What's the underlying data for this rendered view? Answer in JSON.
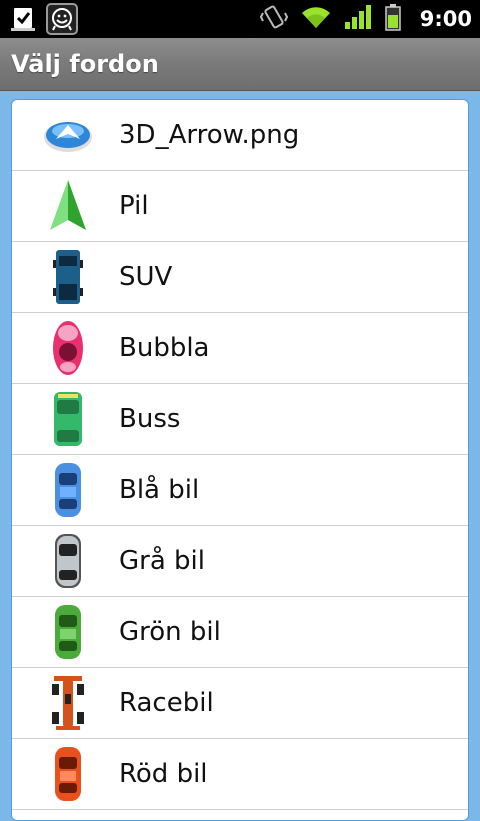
{
  "status": {
    "time": "9:00"
  },
  "header": {
    "title": "Välj fordon"
  },
  "vehicles": [
    {
      "label": "3D_Arrow.png",
      "icon": "3d-arrow-icon"
    },
    {
      "label": "Pil",
      "icon": "green-arrow-icon"
    },
    {
      "label": "SUV",
      "icon": "suv-icon"
    },
    {
      "label": "Bubbla",
      "icon": "bubble-car-icon"
    },
    {
      "label": "Buss",
      "icon": "bus-icon"
    },
    {
      "label": "Blå bil",
      "icon": "blue-car-icon"
    },
    {
      "label": "Grå bil",
      "icon": "gray-car-icon"
    },
    {
      "label": "Grön bil",
      "icon": "green-car-icon"
    },
    {
      "label": "Racebil",
      "icon": "race-car-icon"
    },
    {
      "label": "Röd bil",
      "icon": "red-car-icon"
    }
  ],
  "colors": {
    "accent_blue": "#7ab8ea",
    "titlebar_gray": "#7a7a7a",
    "status_green": "#9be22d"
  }
}
